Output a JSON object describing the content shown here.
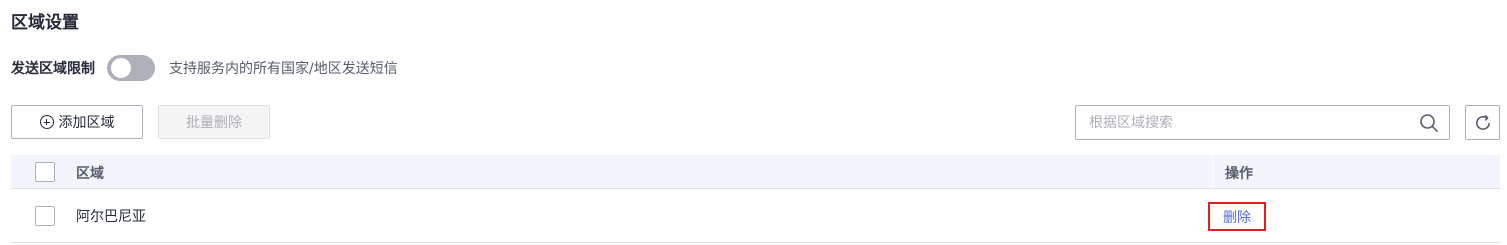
{
  "page": {
    "title": "区域设置"
  },
  "send_limit": {
    "label": "发送区域限制",
    "toggle_on": false,
    "description": "支持服务内的所有国家/地区发送短信"
  },
  "toolbar": {
    "add_label": "添加区域",
    "batch_delete_label": "批量删除",
    "search_placeholder": "根据区域搜索",
    "search_value": ""
  },
  "table": {
    "columns": [
      "区域",
      "操作"
    ],
    "rows": [
      {
        "region": "阿尔巴尼亚",
        "action": "删除"
      }
    ]
  },
  "colors": {
    "link": "#526ecc",
    "highlight_border": "#e02020",
    "header_bg": "#f2f5fc",
    "toggle_off": "#adb0b8"
  },
  "icons": [
    "add-circle-icon",
    "search-icon",
    "refresh-icon"
  ]
}
